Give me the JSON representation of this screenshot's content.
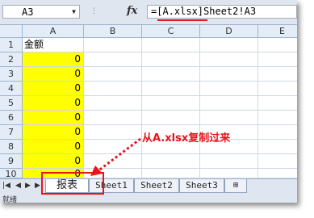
{
  "formula_bar": {
    "name_box": "A3",
    "fx_label": "fx",
    "formula": "=[A.xlsx]Sheet2!A3"
  },
  "columns": [
    "A",
    "B",
    "C",
    "D",
    "E"
  ],
  "rows": [
    "1",
    "2",
    "3",
    "4",
    "5",
    "6",
    "7",
    "8",
    "9",
    "10"
  ],
  "cells": {
    "A1": "金额",
    "A2": "0",
    "A3": "0",
    "A4": "0",
    "A5": "0",
    "A6": "0",
    "A7": "0",
    "A8": "0",
    "A9": "0",
    "A10": "0"
  },
  "sheet_tabs": [
    "报表",
    "Sheet1",
    "Sheet2",
    "Sheet3"
  ],
  "active_sheet": "报表",
  "status_bar": "就绪",
  "annotation": "从A.xlsx复制过来",
  "colors": {
    "cell_fill": "#ffff00",
    "annotation": "#e8141c",
    "header_bg": "#e4ecf7"
  }
}
